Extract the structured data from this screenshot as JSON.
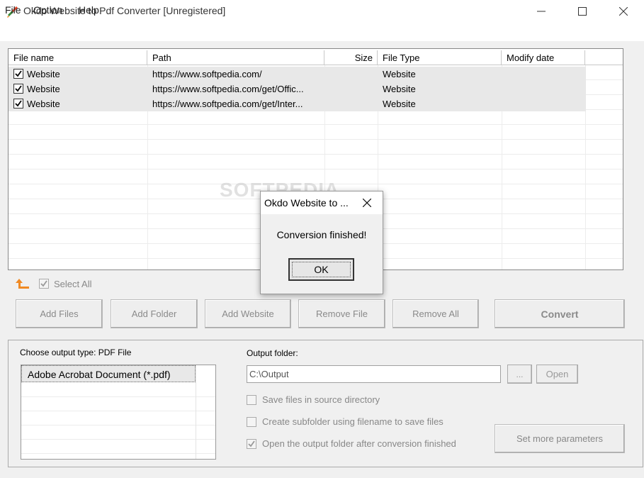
{
  "window": {
    "title": "Okdo Website to Pdf Converter [Unregistered]"
  },
  "menu": [
    "File",
    "Option",
    "Help"
  ],
  "filelist": {
    "columns": [
      "File name",
      "Path",
      "Size",
      "File Type",
      "Modify date"
    ],
    "rows": [
      {
        "checked": true,
        "name": "Website",
        "path": "https://www.softpedia.com/",
        "size": "",
        "type": "Website",
        "modified": ""
      },
      {
        "checked": true,
        "name": "Website",
        "path": "https://www.softpedia.com/get/Offic...",
        "size": "",
        "type": "Website",
        "modified": ""
      },
      {
        "checked": true,
        "name": "Website",
        "path": "https://www.softpedia.com/get/Inter...",
        "size": "",
        "type": "Website",
        "modified": ""
      }
    ]
  },
  "select_all": {
    "label": "Select All",
    "checked": true
  },
  "actions": {
    "add_files": "Add Files",
    "add_folder": "Add Folder",
    "add_website": "Add Website",
    "remove_file": "Remove File",
    "remove_all": "Remove All",
    "convert": "Convert"
  },
  "output": {
    "type_label": "Choose output type:  PDF File",
    "types": [
      "Adobe Acrobat Document (*.pdf)"
    ],
    "folder_label": "Output folder:",
    "folder_value": "C:\\Output",
    "browse_label": "...",
    "open_label": "Open",
    "options": [
      {
        "label": "Save files in source directory",
        "checked": false
      },
      {
        "label": "Create subfolder using filename to save files",
        "checked": false
      },
      {
        "label": "Open the output folder after conversion finished",
        "checked": true
      }
    ],
    "more_params_label": "Set more parameters"
  },
  "watermark": "SOFTPEDIA",
  "dialog": {
    "title": "Okdo Website to ...",
    "message": "Conversion finished!",
    "ok_label": "OK"
  },
  "colors": {
    "accent_orange": "#f08a24",
    "titlebar_bg": "#ffffff",
    "window_bg": "#f0f0f0"
  }
}
